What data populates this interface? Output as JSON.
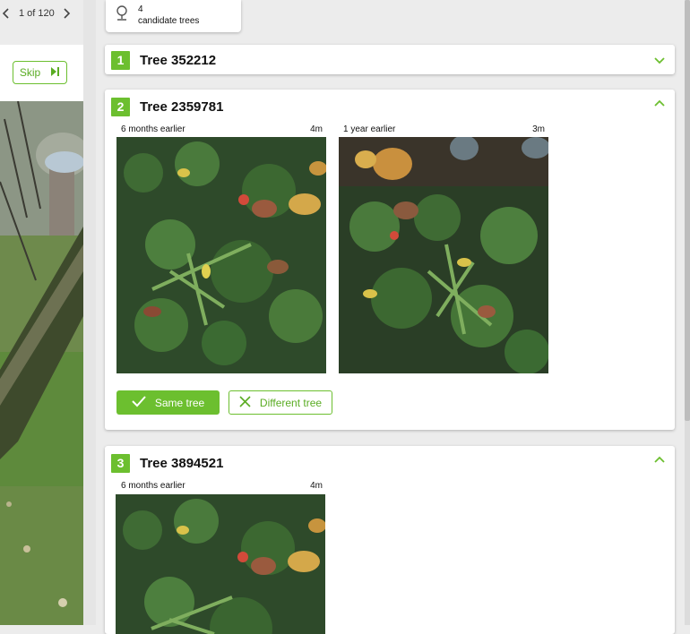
{
  "pager": {
    "text": "1 of 120",
    "prev_icon": "chevron-left-icon",
    "next_icon": "chevron-right-icon"
  },
  "skip": {
    "label": "Skip",
    "icon": "skip-next-icon"
  },
  "candidates": {
    "count": "4",
    "label": "candidate trees",
    "icon": "map-pin-icon"
  },
  "trees": [
    {
      "number": "1",
      "title": "Tree 352212",
      "expanded": false
    },
    {
      "number": "2",
      "title": "Tree 2359781",
      "expanded": true,
      "images": [
        {
          "label": "6 months earlier",
          "distance": "4m"
        },
        {
          "label": "1 year earlier",
          "distance": "3m"
        }
      ],
      "same_label": "Same tree",
      "different_label": "Different tree"
    },
    {
      "number": "3",
      "title": "Tree 3894521",
      "expanded": true,
      "images": [
        {
          "label": "6 months earlier",
          "distance": "4m"
        }
      ]
    }
  ],
  "colors": {
    "accent": "#6cbf2f",
    "accent_text": "#5aac23",
    "background": "#ececec"
  }
}
